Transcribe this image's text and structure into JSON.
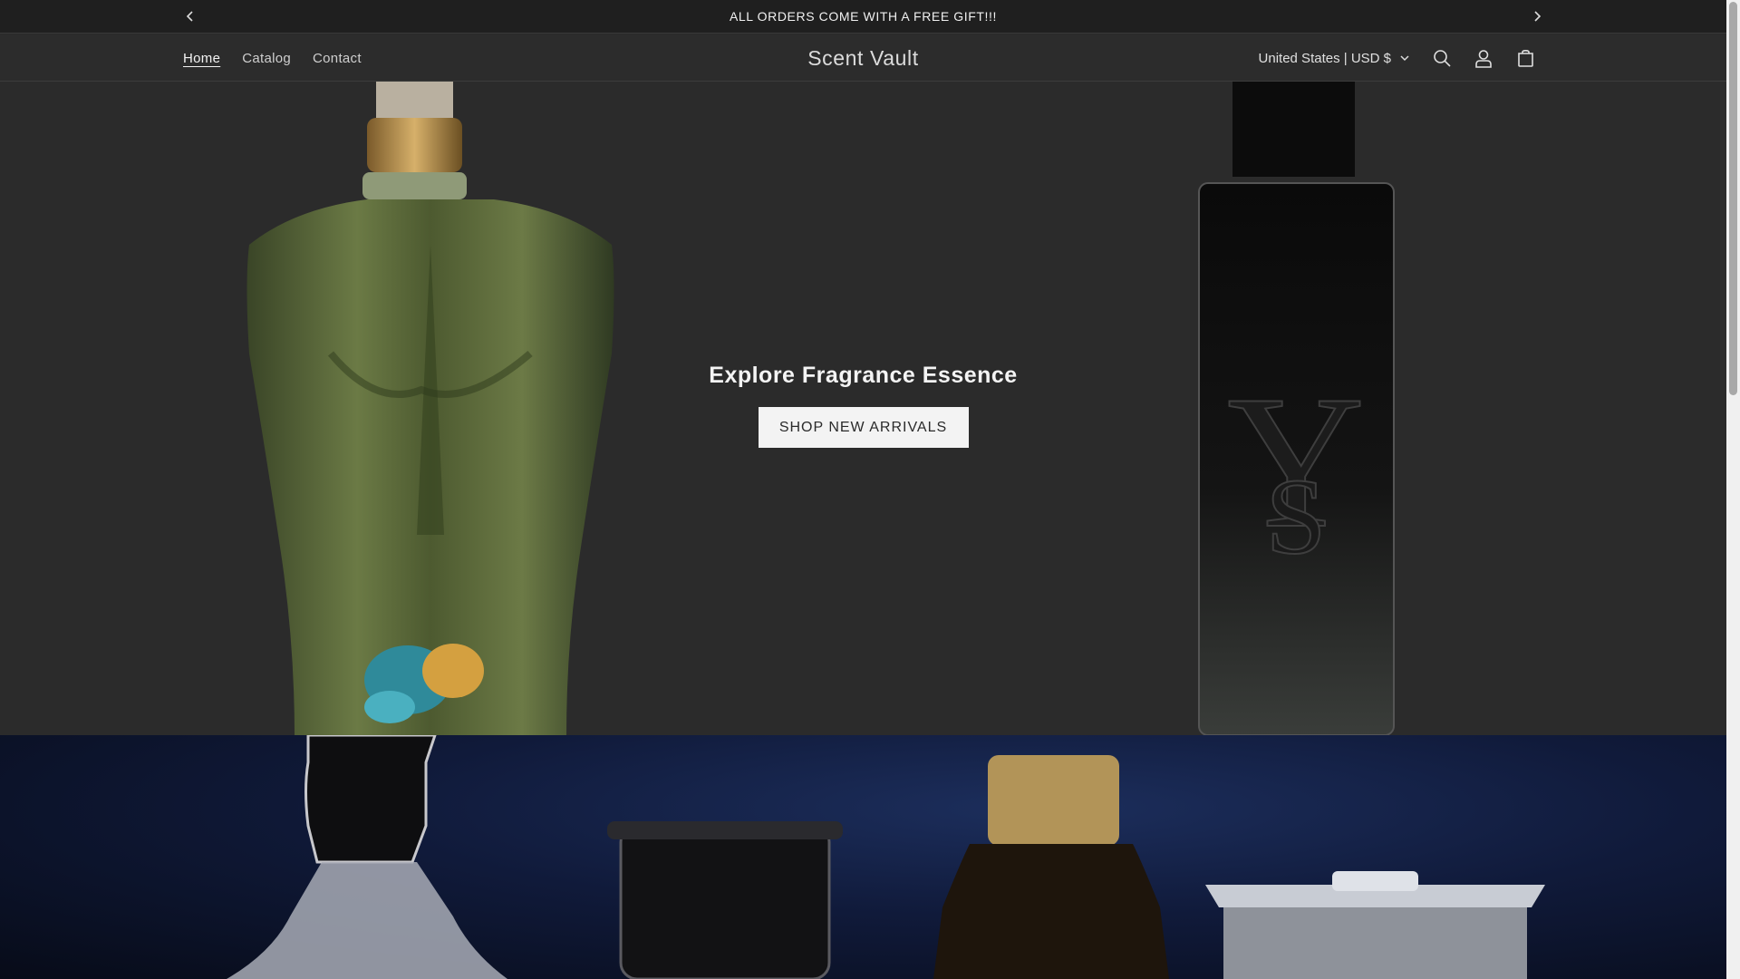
{
  "announcement": {
    "text": "ALL ORDERS COME WITH A FREE GIFT!!!"
  },
  "header": {
    "nav": [
      {
        "label": "Home",
        "active": true
      },
      {
        "label": "Catalog",
        "active": false
      },
      {
        "label": "Contact",
        "active": false
      }
    ],
    "brand": "Scent Vault",
    "locale": "United States | USD $",
    "icons": [
      "search-icon",
      "account-icon",
      "cart-icon"
    ]
  },
  "hero": {
    "title": "Explore Fragrance Essence",
    "button_label": "SHOP NEW ARRIVALS",
    "bottle_left_monogram": "",
    "bottle_right_monogram": "YSL"
  },
  "colors": {
    "announcement_bg": "#1f1f1f",
    "header_bg": "#2c2c2c",
    "hero_bg": "#2b2b2b",
    "button_bg": "#f3f3f3",
    "banner_blue": "#1c2e5c"
  }
}
